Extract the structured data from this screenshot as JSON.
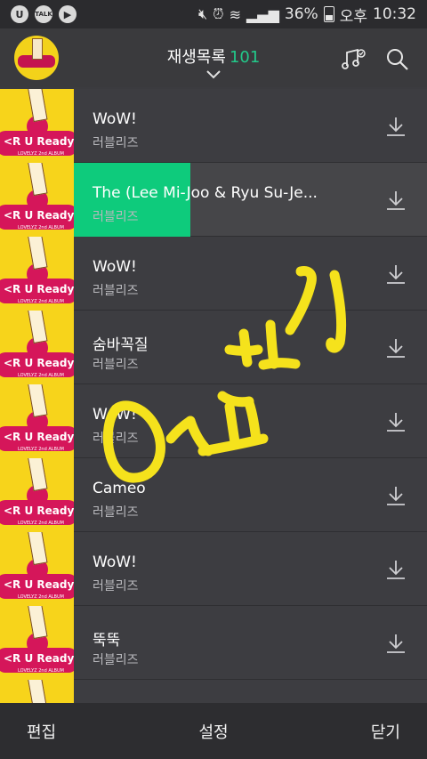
{
  "status_bar": {
    "left_icons": [
      "u-icon",
      "talk-icon",
      "play-icon"
    ],
    "talk_label": "TALK",
    "battery": "36%",
    "time_prefix": "오후",
    "time": "10:32"
  },
  "header": {
    "title": "재생목록",
    "count": "101"
  },
  "playlist": [
    {
      "title": "WoW!",
      "artist": "러블리즈"
    },
    {
      "title": "The (Lee Mi-Joo & Ryu Su-Je...",
      "artist": "러블리즈",
      "progress": 0.33
    },
    {
      "title": "WoW!",
      "artist": "러블리즈"
    },
    {
      "title": "숨바꼭질",
      "artist": "러블리즈"
    },
    {
      "title": "WoW!",
      "artist": "러블리즈"
    },
    {
      "title": "Cameo",
      "artist": "러블리즈"
    },
    {
      "title": "WoW!",
      "artist": "러블리즈"
    },
    {
      "title": "뚝뚝",
      "artist": "러블리즈"
    }
  ],
  "album_art_text": "<R U Ready?>",
  "album_art_subtext": "LOVELYZ 2nd ALBUM",
  "bottom_bar": {
    "edit": "편집",
    "settings": "설정",
    "close": "닫기"
  },
  "colors": {
    "accent": "#22c98a",
    "progress": "#0ecb7c",
    "handwriting": "#f5e21c",
    "album_yellow": "#f7d41b",
    "album_pink": "#d5165a"
  }
}
